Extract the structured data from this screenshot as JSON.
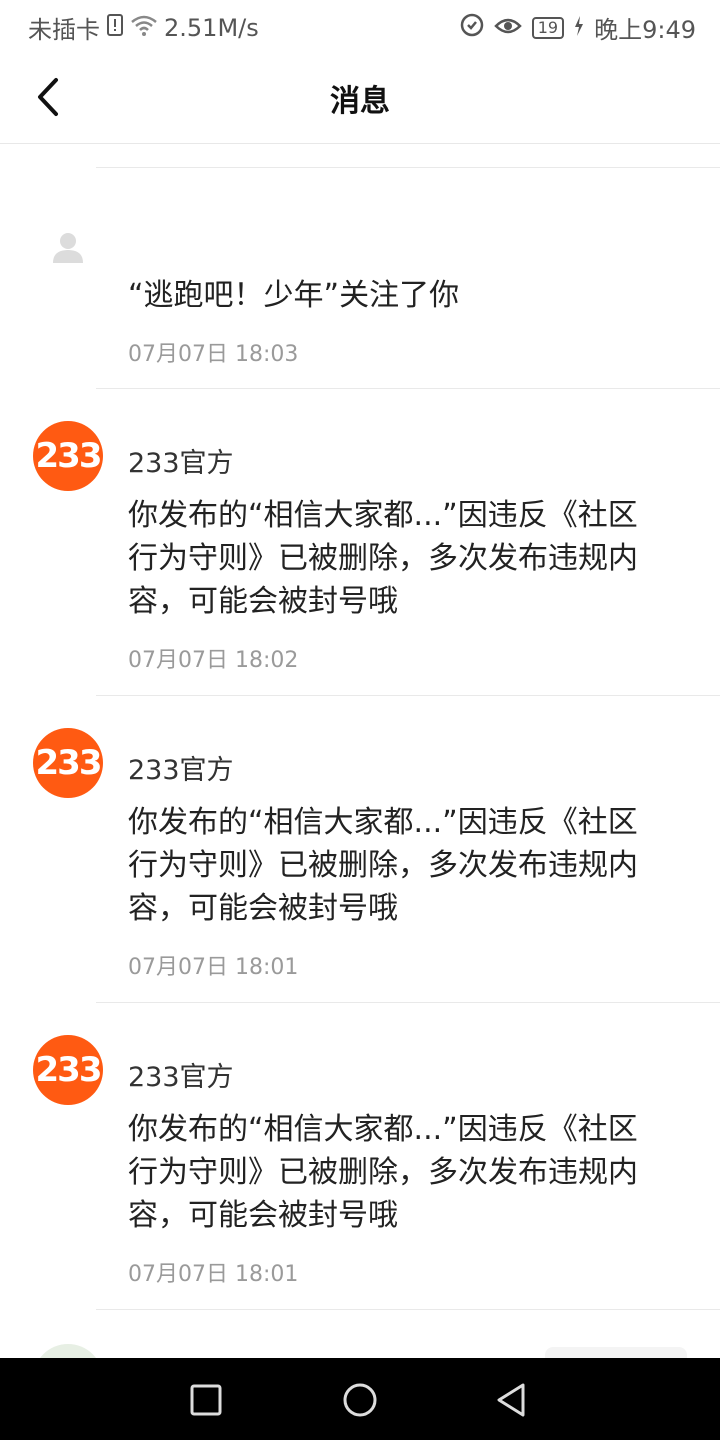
{
  "status_bar": {
    "carrier": "未插卡",
    "speed": "2.51M/s",
    "battery": "19",
    "time": "晚上9:49"
  },
  "header": {
    "title": "消息",
    "back_icon": "chevron-left-icon"
  },
  "messages": [
    {
      "sender": "",
      "text": "“逃跑吧！少年”关注了你",
      "time": "07月07日 18:03",
      "avatar": "default-user-icon"
    },
    {
      "sender": "233官方",
      "text": "你发布的“相信大家都...”因违反《社区行为守则》已被删除，多次发布违规内容，可能会被封号哦",
      "time": "07月07日 18:02",
      "avatar": "brand-233-logo",
      "avatar_text": "233"
    },
    {
      "sender": "233官方",
      "text": "你发布的“相信大家都...”因违反《社区行为守则》已被删除，多次发布违规内容，可能会被封号哦",
      "time": "07月07日 18:01",
      "avatar": "brand-233-logo",
      "avatar_text": "233"
    },
    {
      "sender": "233官方",
      "text": "你发布的“相信大家都...”因违反《社区行为守则》已被删除，多次发布违规内容，可能会被封号哦",
      "time": "07月07日 18:01",
      "avatar": "brand-233-logo",
      "avatar_text": "233"
    }
  ],
  "colors": {
    "brand": "#ff5a12",
    "divider": "#e9e9e9",
    "time_text": "#9a9a9a"
  }
}
